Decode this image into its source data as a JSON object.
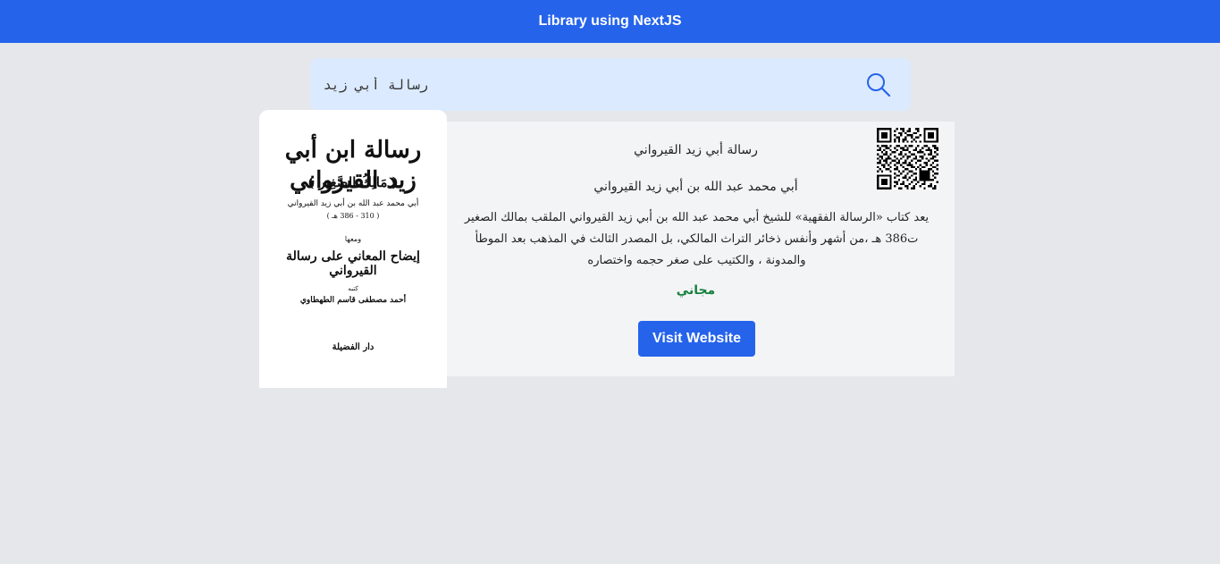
{
  "header": {
    "title": "Library using NextJS",
    "color": "#2563eb"
  },
  "search": {
    "value": "رسالة أبي زيد",
    "icon": "search-icon"
  },
  "book": {
    "cover": {
      "title": "رسالة ابن أبي زيد القيرواني",
      "subtitle": "( مَالِكُ الصَّغِير )",
      "author": "أبي محمد عبد الله بن أبي زيد القيرواني",
      "dates": "( 310 - 386 هـ )",
      "with": "ومعها",
      "title2": "إيضاح المعاني على رسالة القيرواني",
      "by": "كتبه",
      "author2": "أحمد مصطفى قاسم الطهطاوي",
      "publisher": "دار الفضيلة"
    },
    "title": "رسالة أبي زيد القيرواني",
    "author": "أبي محمد عبد الله بن أبي زيد القيرواني",
    "description": "يعد كتاب «الرسالة الفقهية» للشيخ أبي محمد عبد الله بن أبي زيد القيرواني الملقب بمالك الصغير ت386 هـ ،من أشهر وأنفس ذخائر التراث المالكي، بل المصدر الثالث في المذهب بعد الموطأ والمدونة ، والكتيب على صغر حجمه واختصاره",
    "price": "مجاني",
    "price_color": "#15803d",
    "visit_label": "Visit Website"
  }
}
